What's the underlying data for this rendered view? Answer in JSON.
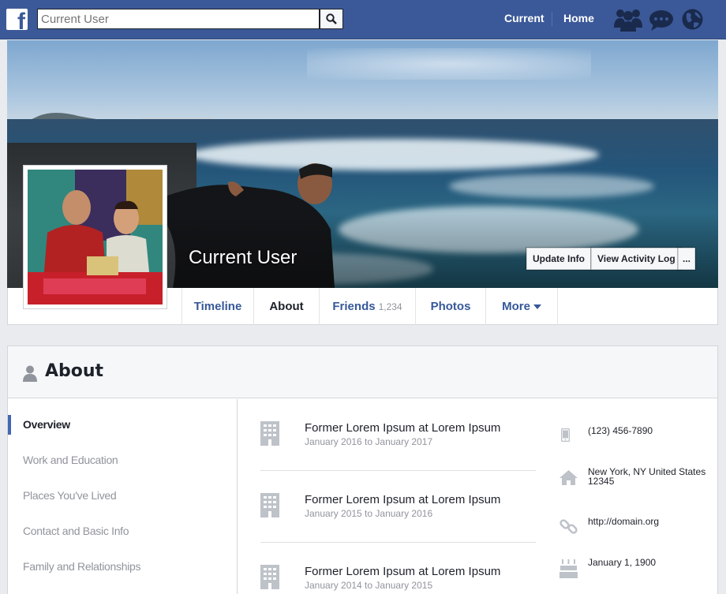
{
  "topbar": {
    "logo_letter": "f",
    "search_placeholder": "Current User",
    "search_value": "",
    "nav": {
      "current": "Current",
      "home": "Home"
    },
    "icons": [
      "friends-icon",
      "messages-icon",
      "globe-icon"
    ]
  },
  "profile": {
    "name": "Current User",
    "buttons": {
      "update_info": "Update Info",
      "activity_log": "View Activity Log",
      "more": "..."
    }
  },
  "tabs": [
    {
      "label": "Timeline"
    },
    {
      "label": "About"
    },
    {
      "label": "Friends",
      "count": "1,234"
    },
    {
      "label": "Photos"
    },
    {
      "label": "More"
    }
  ],
  "about": {
    "title": "About",
    "sidebar": [
      {
        "label": "Overview",
        "active": true
      },
      {
        "label": "Work and Education"
      },
      {
        "label": "Places You've Lived"
      },
      {
        "label": "Contact and Basic Info"
      },
      {
        "label": "Family and Relationships"
      }
    ],
    "work": [
      {
        "title": "Former Lorem Ipsum at Lorem Ipsum",
        "dates": "January 2016 to January 2017"
      },
      {
        "title": "Former Lorem Ipsum at Lorem Ipsum",
        "dates": "January 2015 to January 2016"
      },
      {
        "title": "Former Lorem Ipsum at Lorem Ipsum",
        "dates": "January 2014 to January 2015"
      }
    ],
    "contact": {
      "phone": "(123) 456-7890",
      "location": "New York, NY United States 12345",
      "website": "http://domain.org",
      "birthday": "January 1, 1900"
    }
  },
  "colors": {
    "brand": "#3b5998",
    "link": "#365899",
    "active_marker": "#4267b2",
    "muted_text": "#90949c"
  }
}
